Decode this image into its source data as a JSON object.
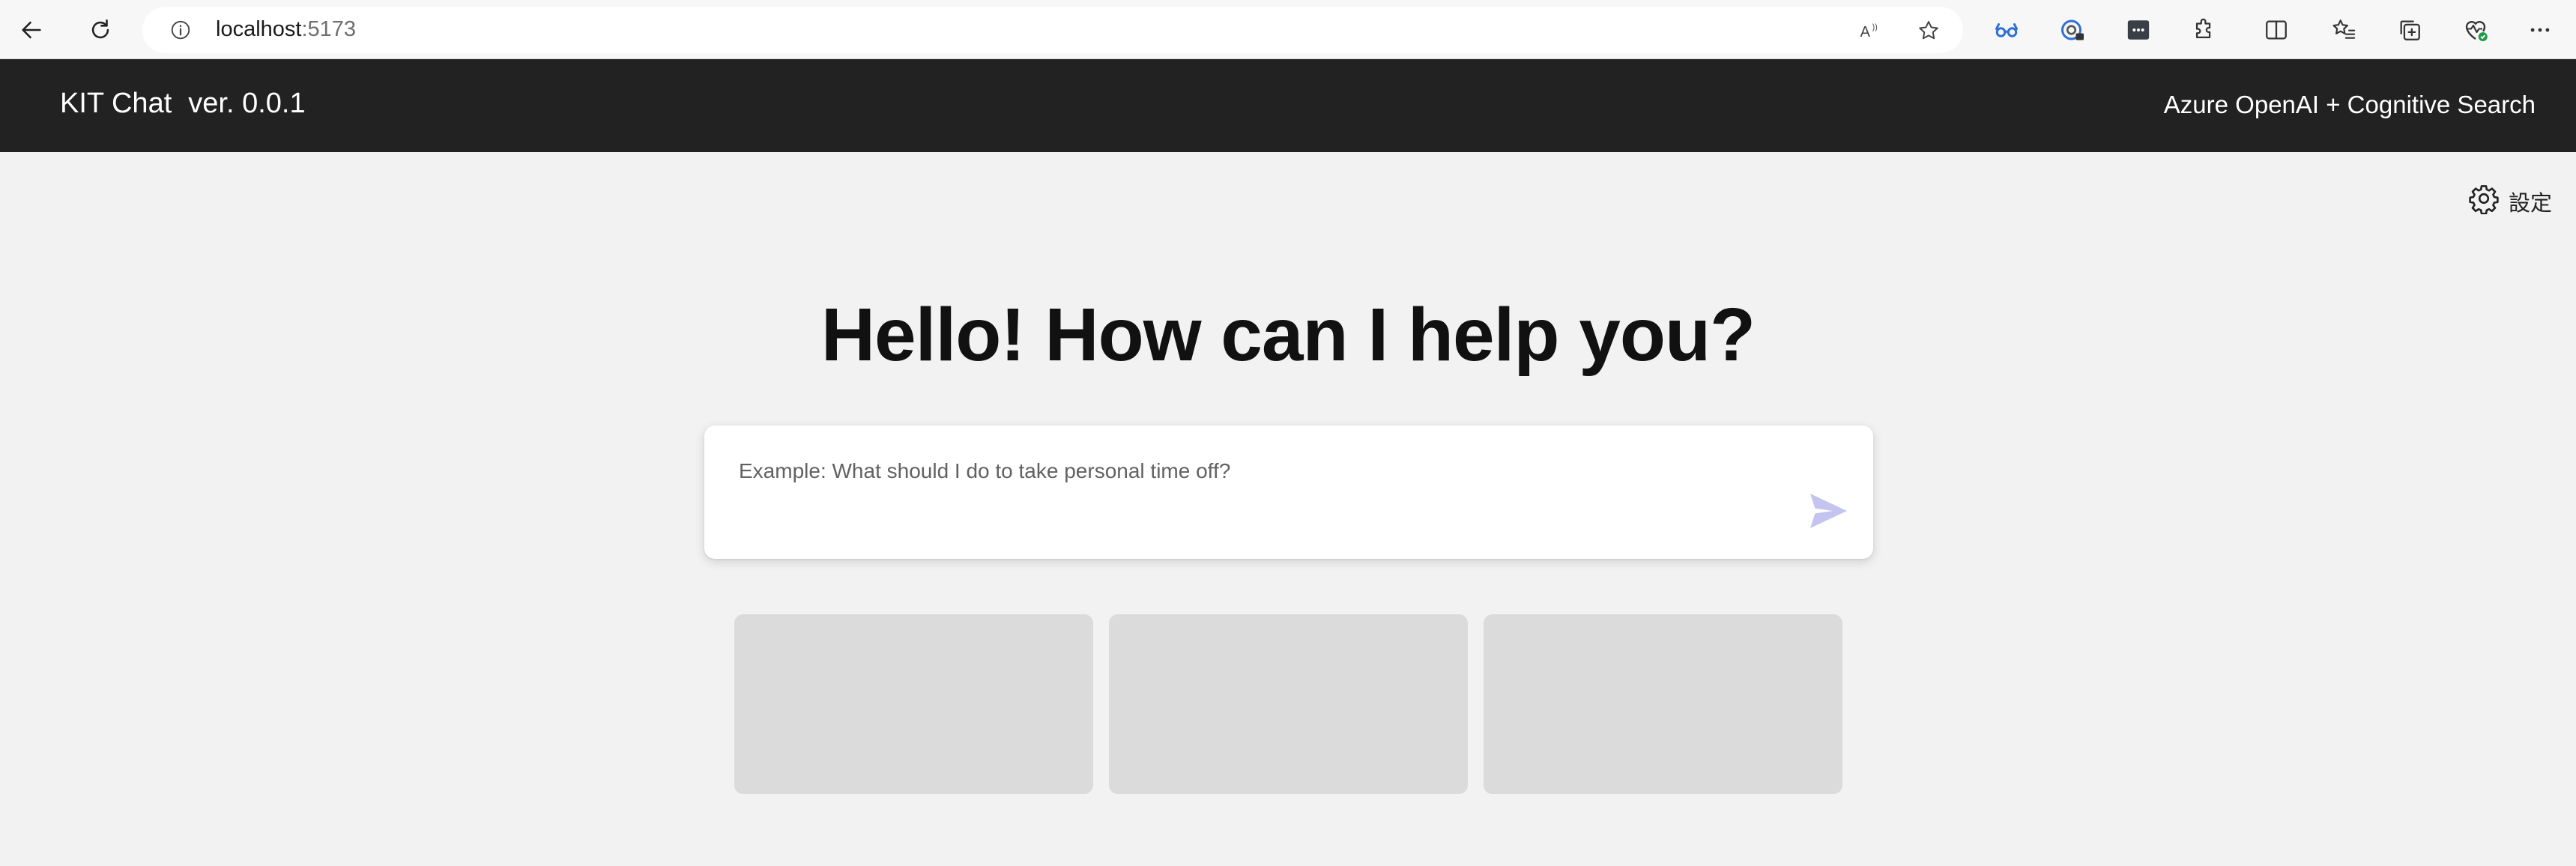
{
  "browser": {
    "url_host": "localhost",
    "url_port": ":5173",
    "icons": [
      "back-icon",
      "refresh-icon",
      "site-info-icon",
      "read-aloud-icon",
      "favorite-star-icon",
      "browser-essentials-icon",
      "password-manager-icon",
      "extension-icon",
      "extensions-puzzle-icon",
      "split-screen-icon",
      "favorites-icon",
      "collections-icon",
      "health-icon",
      "more-icon"
    ]
  },
  "header": {
    "brand": "KIT Chat",
    "version": "ver. 0.0.1",
    "subtitle": "Azure OpenAI + Cognitive Search"
  },
  "settings": {
    "label": "設定",
    "icon": "gear-icon"
  },
  "hero": {
    "title": "Hello! How can I help you?"
  },
  "chat": {
    "placeholder": "Example: What should I do to take personal time off?",
    "value": "",
    "send_icon": "send-icon",
    "send_color": "#c5c4f0"
  },
  "examples": [
    "",
    "",
    ""
  ],
  "colors": {
    "header_bg": "#222222",
    "page_bg": "#f2f2f2",
    "example_card_bg": "#dbdbdb",
    "accent_blue": "#2f6fd6"
  }
}
